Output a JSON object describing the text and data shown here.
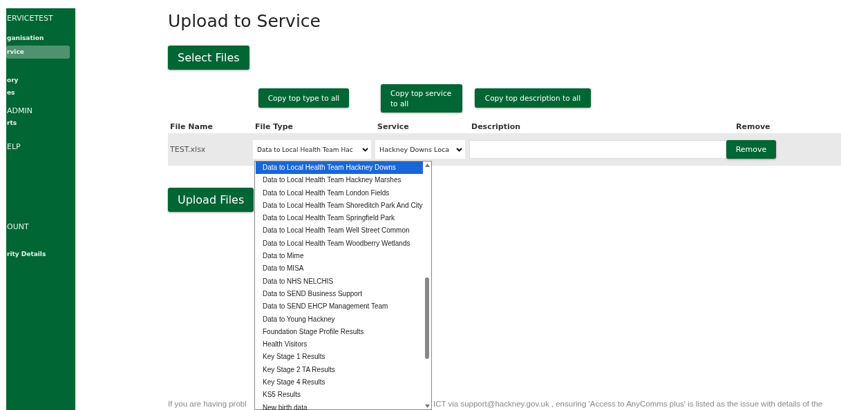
{
  "sidebar": {
    "header": "ERVICETEST",
    "items": [
      {
        "label": "ganisation",
        "kind": "link",
        "selected": false
      },
      {
        "label": "rvice",
        "kind": "link",
        "selected": true
      },
      {
        "label": "ory",
        "kind": "link",
        "selected": false
      },
      {
        "label": "es",
        "kind": "link",
        "selected": false
      },
      {
        "label": "ADMIN",
        "kind": "heading",
        "selected": false
      },
      {
        "label": "rts",
        "kind": "link",
        "selected": false
      },
      {
        "label": "ELP",
        "kind": "heading",
        "selected": false
      },
      {
        "label": "OUNT",
        "kind": "heading",
        "selected": false
      },
      {
        "label": "rity Details",
        "kind": "link",
        "selected": false
      }
    ]
  },
  "page": {
    "title": "Upload to Service",
    "select_button": "Select Files",
    "copy_buttons": [
      "Copy top type to all",
      "Copy top service to all",
      "Copy top description to all"
    ],
    "columns": [
      "File Name",
      "File Type",
      "Service",
      "Description",
      "Remove"
    ],
    "rows": [
      {
        "file_name": "TEST.xlsx",
        "file_type": "Data to Local Health Team Hac",
        "service": "Hackney Downs Loca",
        "description": "",
        "remove": "Remove"
      }
    ],
    "upload_button": "Upload Files",
    "dropdown": {
      "options": [
        {
          "label": "Data to Local Health Team Hackney Downs",
          "selected": true
        },
        {
          "label": "Data to Local Health Team Hackney Marshes",
          "selected": false
        },
        {
          "label": "Data to Local Health Team London Fields",
          "selected": false
        },
        {
          "label": "Data to Local Health Team Shoreditch Park And City",
          "selected": false
        },
        {
          "label": "Data to Local Health Team Springfield Park",
          "selected": false
        },
        {
          "label": "Data to Local Health Team Well Street Common",
          "selected": false
        },
        {
          "label": "Data to Local Health Team Woodberry Wetlands",
          "selected": false
        },
        {
          "label": "Data to Mime",
          "selected": false
        },
        {
          "label": "Data to MISA",
          "selected": false
        },
        {
          "label": "Data to NHS NELCHIS",
          "selected": false
        },
        {
          "label": "Data to SEND Business Support",
          "selected": false
        },
        {
          "label": "Data to SEND EHCP Management Team",
          "selected": false
        },
        {
          "label": "Data to Young Hackney",
          "selected": false
        },
        {
          "label": "Foundation Stage Profile Results",
          "selected": false
        },
        {
          "label": "Health Visitors",
          "selected": false
        },
        {
          "label": "Key Stage 1 Results",
          "selected": false
        },
        {
          "label": "Key Stage 2 TA Results",
          "selected": false
        },
        {
          "label": "Key Stage 4 Results",
          "selected": false
        },
        {
          "label": "KS5 Results",
          "selected": false
        },
        {
          "label": "New birth data",
          "selected": false
        }
      ]
    },
    "footer": [
      "If you are having probl",
      "ICT via support@hackney.gov.uk , ensuring 'Access to AnyComms plus' is listed as the issue with details of the"
    ]
  }
}
